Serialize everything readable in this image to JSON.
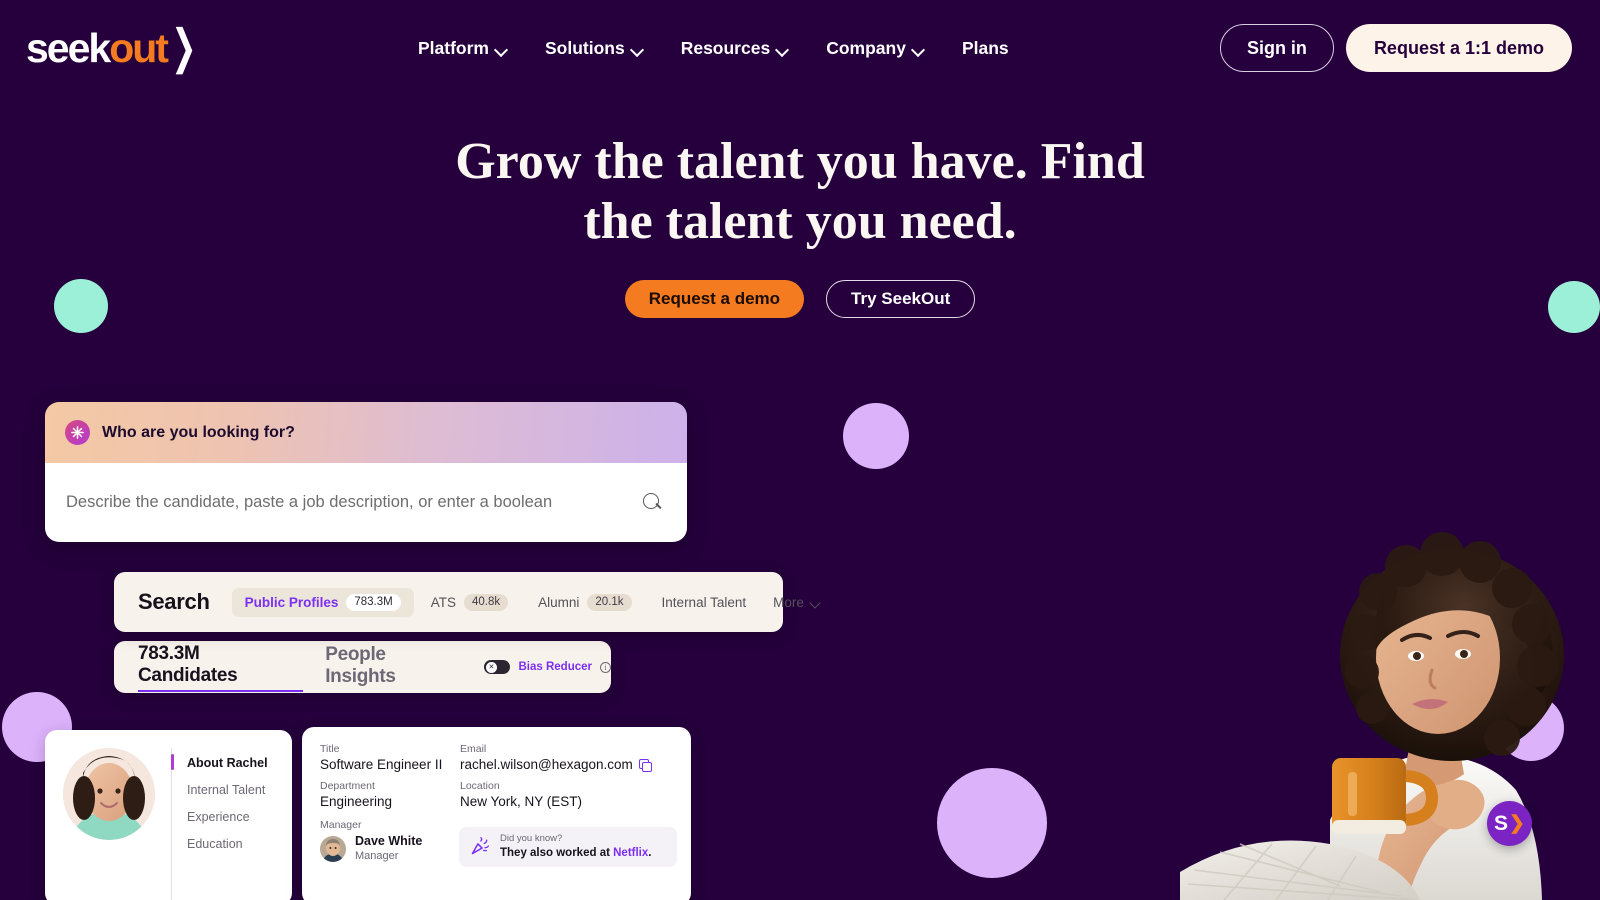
{
  "brand": {
    "name_part1": "seek",
    "name_part2": "out",
    "chevron": "❯",
    "accent_orange": "#f47b20",
    "bg_purple": "#25003c",
    "accent_purple": "#7b2ff2"
  },
  "nav": {
    "items": [
      {
        "label": "Platform",
        "has_dropdown": true
      },
      {
        "label": "Solutions",
        "has_dropdown": true
      },
      {
        "label": "Resources",
        "has_dropdown": true
      },
      {
        "label": "Company",
        "has_dropdown": true
      },
      {
        "label": "Plans",
        "has_dropdown": false
      }
    ],
    "sign_in": "Sign in",
    "request_demo": "Request a 1:1 demo"
  },
  "hero": {
    "heading": "Grow the talent you have. Find the talent you need.",
    "cta_primary": "Request a demo",
    "cta_secondary": "Try SeekOut"
  },
  "ai_search": {
    "header_label": "Who are you looking for?",
    "icon": "sparkle-icon",
    "placeholder": "Describe the candidate, paste a job description, or enter a boolean",
    "value": "",
    "search_icon": "search-icon"
  },
  "search_card": {
    "title": "Search",
    "tabs": [
      {
        "label": "Public Profiles",
        "count": "783.3M",
        "active": true
      },
      {
        "label": "ATS",
        "count": "40.8k",
        "active": false
      },
      {
        "label": "Alumni",
        "count": "20.1k",
        "active": false
      },
      {
        "label": "Internal Talent",
        "count": "",
        "active": false
      }
    ],
    "more_label": "More"
  },
  "results_card": {
    "tabs": [
      {
        "label": "783.3M Candidates",
        "active": true
      },
      {
        "label": "People Insights",
        "active": false
      }
    ],
    "bias_reducer": {
      "label": "Bias Reducer",
      "enabled": false,
      "knob_glyph": "✕",
      "info_glyph": "i"
    }
  },
  "profile_left": {
    "avatar_alt": "Rachel headshot",
    "nav_items": [
      {
        "label": "About Rachel",
        "active": true
      },
      {
        "label": "Internal Talent",
        "active": false
      },
      {
        "label": "Experience",
        "active": false
      },
      {
        "label": "Education",
        "active": false
      }
    ]
  },
  "profile_right": {
    "fields": [
      {
        "label": "Title",
        "value": "Software Engineer II"
      },
      {
        "label": "Email",
        "value": "rachel.wilson@hexagon.com",
        "copyable": true
      },
      {
        "label": "Department",
        "value": "Engineering"
      },
      {
        "label": "Location",
        "value": "New York, NY (EST)"
      }
    ],
    "manager_label": "Manager",
    "manager_name": "Dave White",
    "manager_role": "Manager",
    "did_you_know": {
      "icon": "party-popper-icon",
      "title": "Did you know?",
      "text_before": "They also worked at ",
      "company": "Netflix",
      "text_after": "."
    }
  },
  "chat_widget": {
    "letter": "S",
    "arrow": "❯",
    "color": "#7c23c4"
  },
  "decorations": {
    "mint": "#9df0d8",
    "lavender": "#dcb2fb"
  }
}
